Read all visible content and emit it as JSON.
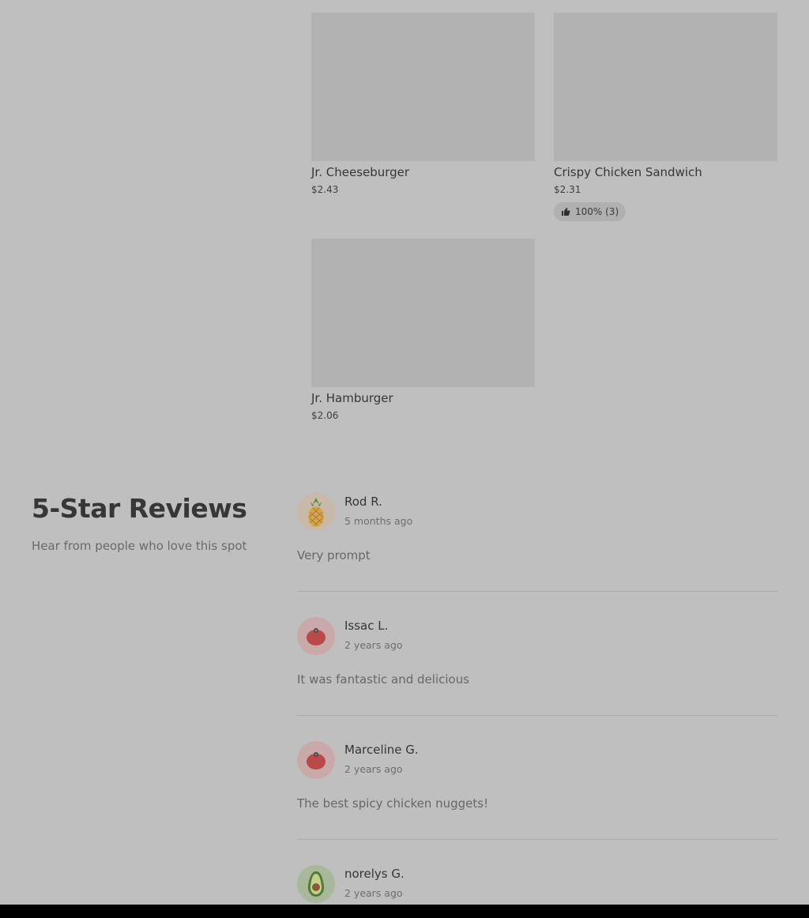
{
  "menu_items": [
    {
      "name": "Jr. Cheeseburger",
      "price": "$2.43"
    },
    {
      "name": "Crispy Chicken Sandwich",
      "price": "$2.31",
      "rating": "100% (3)"
    },
    {
      "name": "Jr. Hamburger",
      "price": "$2.06"
    }
  ],
  "reviews_section": {
    "title": "5-Star Reviews",
    "subtitle": "Hear from people who love this spot",
    "reviews": [
      {
        "name": "Rod R.",
        "time": "5 months ago",
        "text": "Very prompt",
        "avatar_icon": "pineapple-icon"
      },
      {
        "name": "Issac L.",
        "time": "2 years ago",
        "text": "It was fantastic and delicious",
        "avatar_icon": "tomato-icon"
      },
      {
        "name": "Marceline G.",
        "time": "2 years ago",
        "text": "The best spicy chicken nuggets!",
        "avatar_icon": "tomato-icon"
      },
      {
        "name": "norelys G.",
        "time": "2 years ago",
        "avatar_icon": "avocado-icon"
      }
    ]
  },
  "colors": {
    "overlay_bg": "#bfbfbf",
    "placeholder": "#b2b2b2"
  }
}
